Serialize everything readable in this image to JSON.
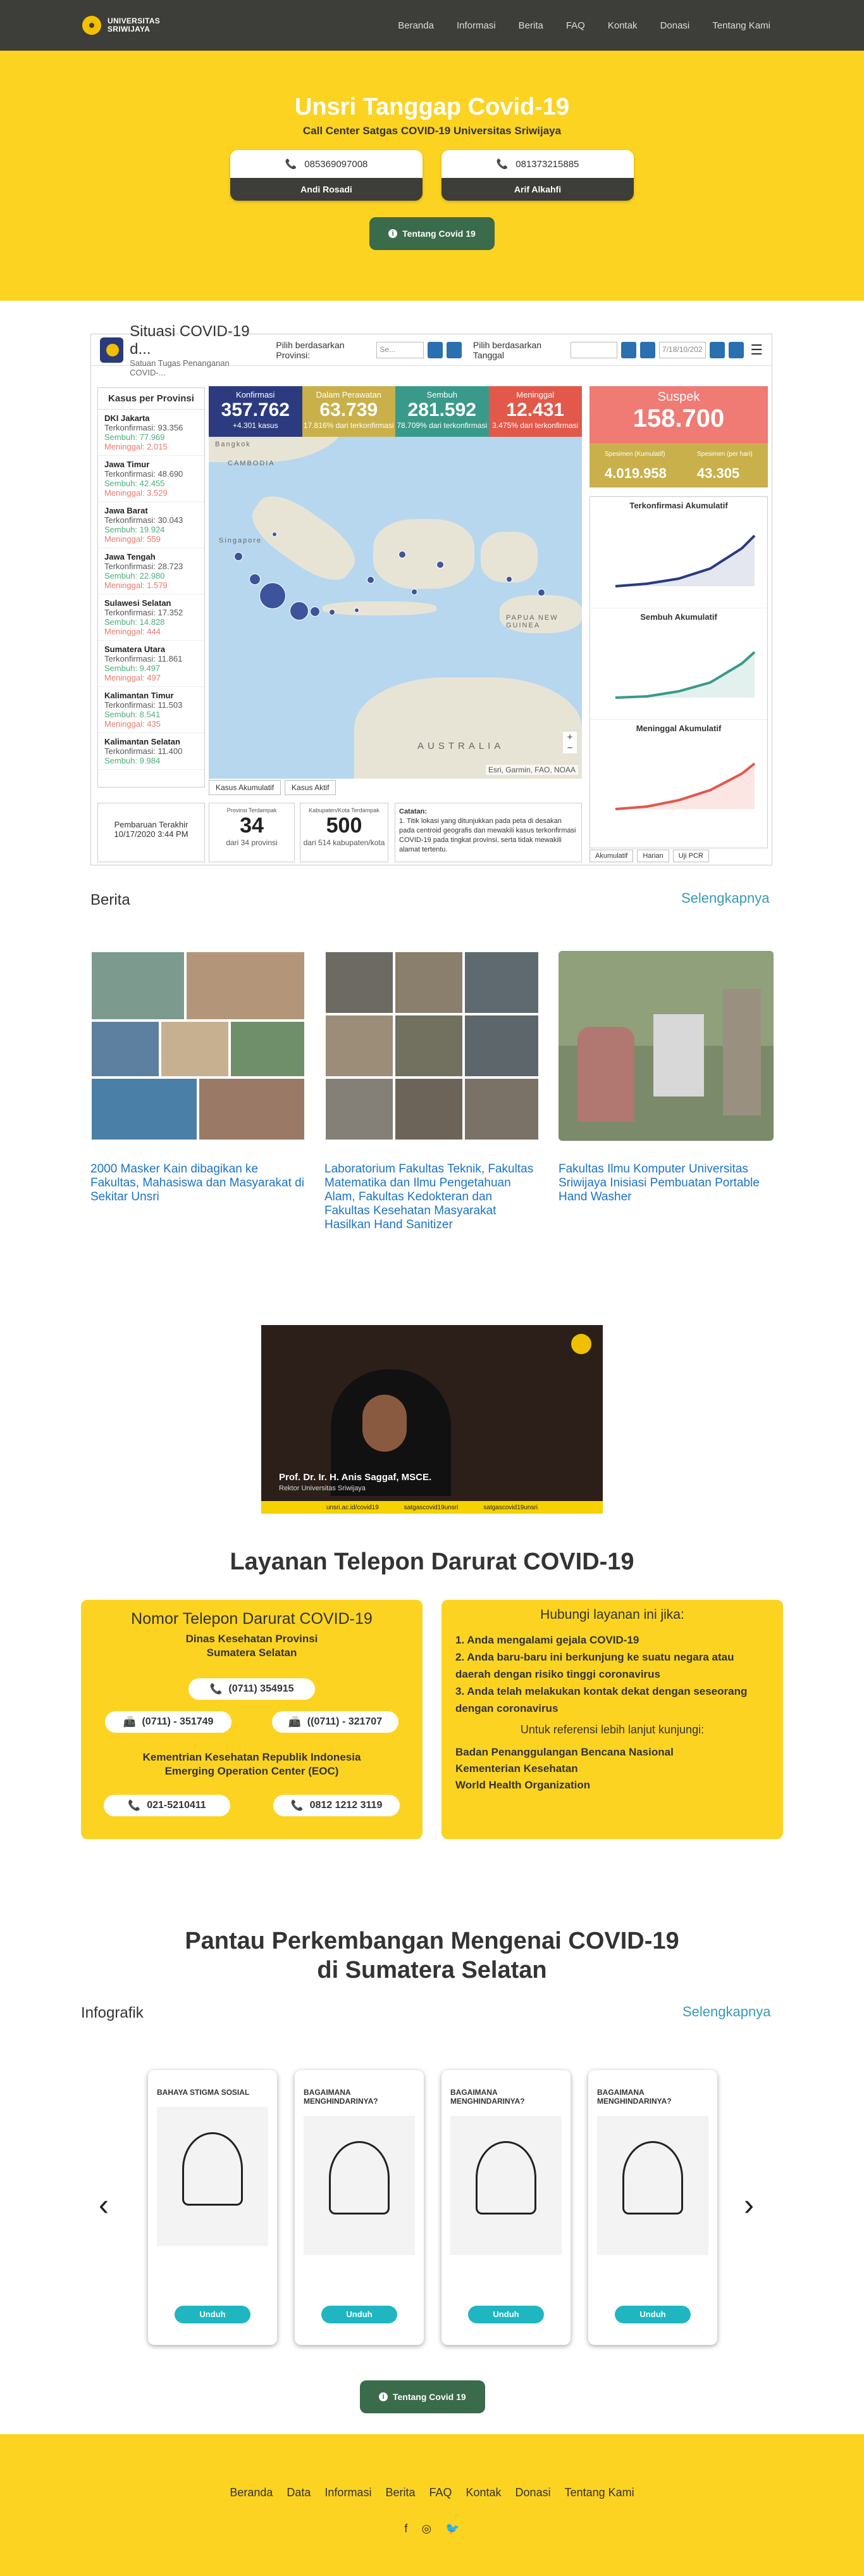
{
  "nav": {
    "logo_line1": "UNIVERSITAS",
    "logo_line2": "SRIWIJAYA",
    "links": [
      "Beranda",
      "Informasi",
      "Berita",
      "FAQ",
      "Kontak",
      "Donasi",
      "Tentang Kami"
    ]
  },
  "hero": {
    "title": "Unsri Tanggap Covid-19",
    "subtitle": "Call Center Satgas COVID-19 Universitas Sriwijaya",
    "contacts": [
      {
        "phone": "085369097008",
        "name": "Andi Rosadi"
      },
      {
        "phone": "081373215885",
        "name": "Arif Alkahfi"
      }
    ],
    "button": "Tentang Covid 19"
  },
  "dashboard": {
    "title": "Situasi COVID-19 d...",
    "subtitle": "Satuan Tugas Penanganan COVID-...",
    "filter_prov": "Pilih berdasarkan Provinsi:",
    "filter_prov_value": "Se...",
    "filter_date": "Pilih berdasarkan Tanggal",
    "filter_date_value": "7/18/10/202",
    "prov_header": "Kasus per Provinsi",
    "provinces": [
      {
        "name": "DKI Jakarta",
        "conf": "Terkonfirmasi: 93.356",
        "rec": "Sembuh: 77.969",
        "die": "Meninggal: 2.015"
      },
      {
        "name": "Jawa Timur",
        "conf": "Terkonfirmasi: 48.690",
        "rec": "Sembuh: 42.455",
        "die": "Meninggal: 3.529"
      },
      {
        "name": "Jawa Barat",
        "conf": "Terkonfirmasi: 30.043",
        "rec": "Sembuh: 19.924",
        "die": "Meninggal: 559"
      },
      {
        "name": "Jawa Tengah",
        "conf": "Terkonfirmasi: 28.723",
        "rec": "Sembuh: 22.980",
        "die": "Meninggal: 1.579"
      },
      {
        "name": "Sulawesi Selatan",
        "conf": "Terkonfirmasi: 17.352",
        "rec": "Sembuh: 14.828",
        "die": "Meninggal: 444"
      },
      {
        "name": "Sumatera Utara",
        "conf": "Terkonfirmasi: 11.861",
        "rec": "Sembuh: 9.497",
        "die": "Meninggal: 497"
      },
      {
        "name": "Kalimantan Timur",
        "conf": "Terkonfirmasi: 11.503",
        "rec": "Sembuh: 8.541",
        "die": "Meninggal: 435"
      },
      {
        "name": "Kalimantan Selatan",
        "conf": "Terkonfirmasi: 11.400",
        "rec": "Sembuh: 9.984",
        "die": ""
      }
    ],
    "kpis": [
      {
        "label": "Konfirmasi",
        "value": "357.762",
        "sub": "+4.301 kasus"
      },
      {
        "label": "Dalam Perawatan",
        "value": "63.739",
        "sub": "17.816% dari terkonfirmasi"
      },
      {
        "label": "Sembuh",
        "value": "281.592",
        "sub": "78.709% dari terkonfirmasi"
      },
      {
        "label": "Meninggal",
        "value": "12.431",
        "sub": "3.475% dari terkonfirmasi"
      }
    ],
    "suspek": {
      "label": "Suspek",
      "value": "158.700"
    },
    "spesimen": [
      {
        "label": "Spesimen (Kumulatif)",
        "value": "4.019.958"
      },
      {
        "label": "Spesimen (per hari)",
        "value": "43.305"
      }
    ],
    "chart_titles": [
      "Terkonfirmasi Akumulatif",
      "Sembuh Akumulatif",
      "Meninggal Akumulatif"
    ],
    "chart_tabs": [
      "Akumulatif",
      "Harian",
      "Uji PCR"
    ],
    "map_tabs": [
      "Kasus Akumulatif",
      "Kasus Aktif"
    ],
    "map_labels": [
      "CAMBODIA",
      "Singapore",
      "PAPUA NEW GUINEA",
      "AUSTRALIA",
      "Bangkok"
    ],
    "map_credit": "Esri, Garmin, FAO, NOAA",
    "update_label": "Pembaruan Terakhir",
    "update_value": "10/17/2020 3:44 PM",
    "prov_stat": {
      "label": "Provinsi Terdampak",
      "value": "34",
      "sub": "dari 34 provinsi"
    },
    "kab_stat": {
      "label": "Kabupaten/Kota Terdampak",
      "value": "500",
      "sub": "dari 514 kabupaten/kota"
    },
    "note_title": "Catatan:",
    "note_text": "1. Titik lokasi yang ditunjukkan pada peta di desakan pada centroid geografis dan mewakili kasus terkonfirmasi COVID-19 pada tingkat provinsi, serta tidak mewakili alamat tertentu."
  },
  "berita": {
    "title": "Berita",
    "more": "Selengkapnya",
    "items": [
      "2000 Masker Kain dibagikan ke Fakultas, Mahasiswa dan Masyarakat di Sekitar Unsri",
      "Laboratorium Fakultas Teknik, Fakultas Matematika dan Ilmu Pengetahuan Alam, Fakultas Kedokteran dan Fakultas Kesehatan Masyarakat Hasilkan Hand Sanitizer",
      "Fakultas Ilmu Komputer Universitas Sriwijaya Inisiasi Pembuatan Portable Hand Washer"
    ]
  },
  "video": {
    "name": "Prof. Dr. Ir. H. Anis Saggaf, MSCE.",
    "role": "Rektor Universitas Sriwijaya",
    "socials": [
      "unsri.ac.id/covid19",
      "satgascovid19unsri",
      "satgascovid19unsri"
    ]
  },
  "darurat": {
    "title": "Layanan Telepon Darurat COVID-19",
    "left_title": "Nomor Telepon Darurat COVID-19",
    "dinkes": "Dinas Kesehatan Provinsi Sumatera Selatan",
    "dinkes_phone": "(0711) 354915",
    "fax1": "(0711) - 351749",
    "fax2": "((0711) - 321707",
    "kemenkes": "Kementrian Kesehatan Republik Indonesia Emerging Operation Center (EOC)",
    "eoc_phone1": "021-5210411",
    "eoc_phone2": "0812 1212 3119",
    "right_title": "Hubungi layanan ini jika:",
    "conditions": [
      "1. Anda mengalami gejala COVID-19",
      "2. Anda baru-baru ini berkunjung ke suatu negara atau daerah dengan risiko tinggi coronavirus",
      "3. Anda telah melakukan kontak dekat dengan seseorang dengan coronavirus"
    ],
    "ref_title": "Untuk referensi lebih lanjut kunjungi:",
    "refs": [
      "Badan Penanggulangan Bencana Nasional",
      "Kementerian Kesehatan",
      "World Health Organization"
    ]
  },
  "pantau": {
    "title_line1": "Pantau Perkembangan Mengenai COVID-19",
    "title_line2": "di Sumatera Selatan",
    "sub": "Infografik",
    "more": "Selengkapnya",
    "cards": [
      "BAHAYA STIGMA SOSIAL",
      "BAGAIMANA MENGHINDARINYA?",
      "BAGAIMANA MENGHINDARINYA?",
      "BAGAIMANA MENGHINDARINYA?"
    ],
    "download": "Unduh",
    "button": "Tentang Covid 19"
  },
  "footer": {
    "links": [
      "Beranda",
      "Data",
      "Informasi",
      "Berita",
      "FAQ",
      "Kontak",
      "Donasi",
      "Tentang Kami"
    ],
    "socials": [
      "f",
      "◎",
      "🐦"
    ]
  },
  "colors": {
    "brand_yellow": "#fcd321",
    "nav_dark": "#3d3d39",
    "green_button": "#3a6b4a",
    "link_blue": "#1a73c8"
  }
}
